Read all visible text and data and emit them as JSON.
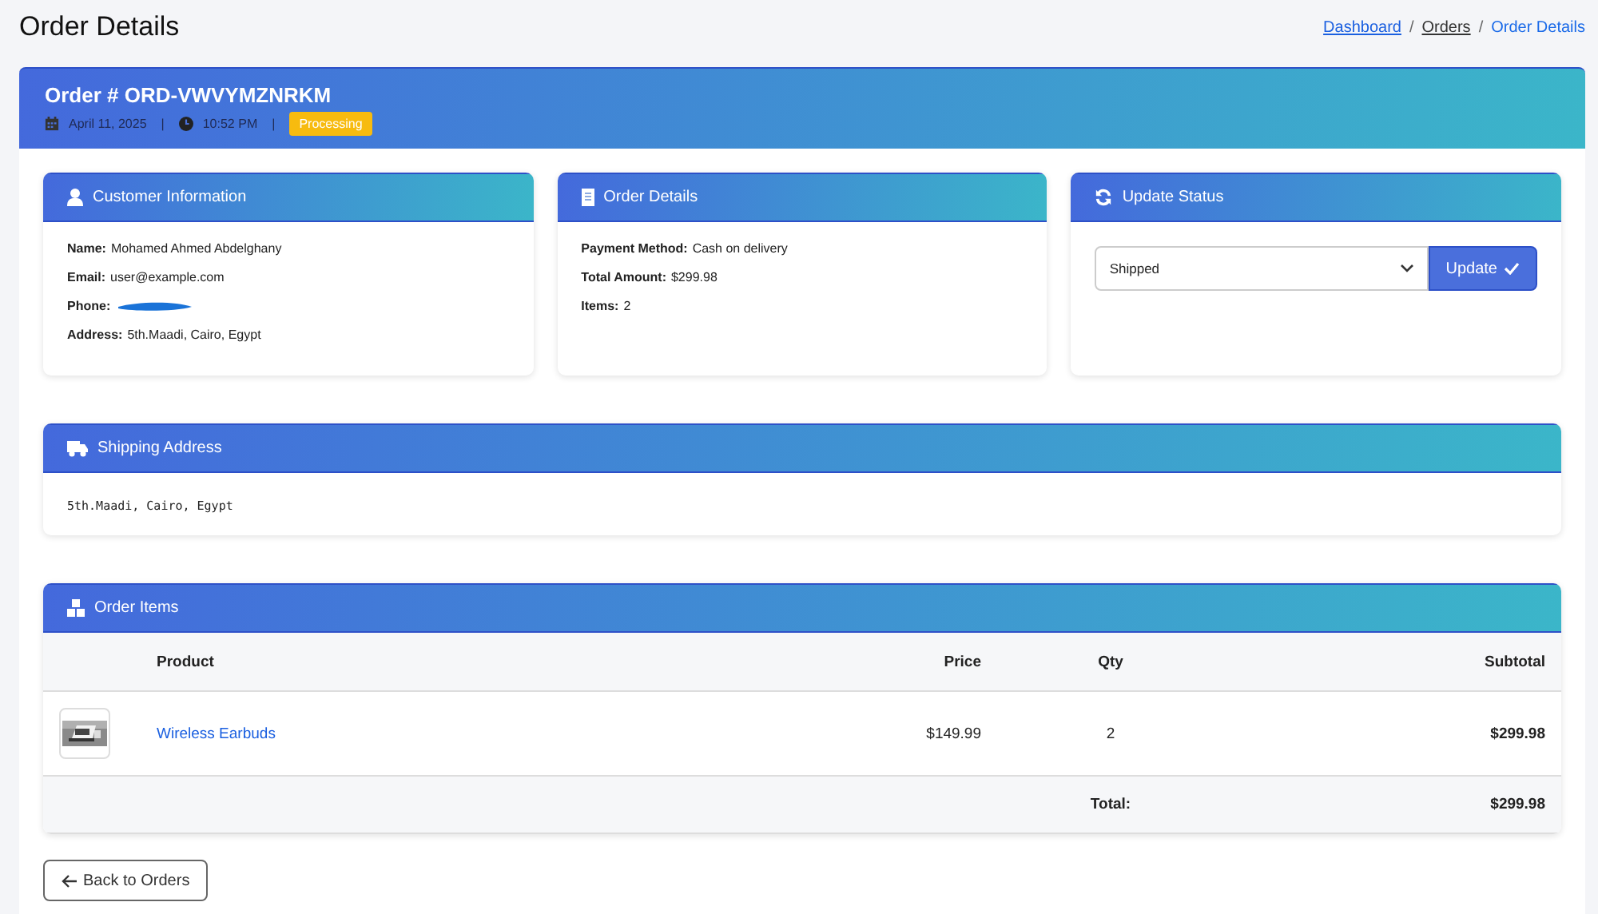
{
  "page_title": "Order Details",
  "breadcrumb_separator": "/",
  "breadcrumb": [
    {
      "label": "Dashboard",
      "kind": "link"
    },
    {
      "label": "Orders",
      "kind": "visited"
    },
    {
      "label": "Order Details",
      "kind": "current"
    }
  ],
  "order": {
    "title": "Order # ORD-VWVYMZNRKM",
    "date": "April 11, 2025",
    "time": "10:52 PM",
    "status": "Processing",
    "separator": "|"
  },
  "customer": {
    "title": "Customer Information",
    "fields": [
      {
        "label": "Name:",
        "value": "Mohamed Ahmed Abdelghany"
      },
      {
        "label": "Email:",
        "value": "user@example.com"
      },
      {
        "label": "Phone:",
        "redacted": true
      },
      {
        "label": "Address:",
        "value": "5th.Maadi, Cairo, Egypt"
      }
    ]
  },
  "details": {
    "title": "Order Details",
    "fields": [
      {
        "label": "Payment Method:",
        "value": "Cash on delivery"
      },
      {
        "label": "Total Amount:",
        "value": "$299.98"
      },
      {
        "label": "Items:",
        "value": "2"
      }
    ]
  },
  "update_status": {
    "title": "Update Status",
    "value": "Shipped",
    "button": "Update"
  },
  "shipping": {
    "title": "Shipping Address",
    "address": "5th.Maadi, Cairo, Egypt"
  },
  "items": {
    "title": "Order Items",
    "columns": [
      "Product",
      "Price",
      "Qty",
      "Subtotal"
    ],
    "rows": [
      {
        "product": "Wireless Earbuds",
        "price": "$149.99",
        "qty": "2",
        "subtotal": "$299.98"
      }
    ],
    "total_label": "Total:",
    "total": "$299.98"
  },
  "back_button": "Back to Orders"
}
